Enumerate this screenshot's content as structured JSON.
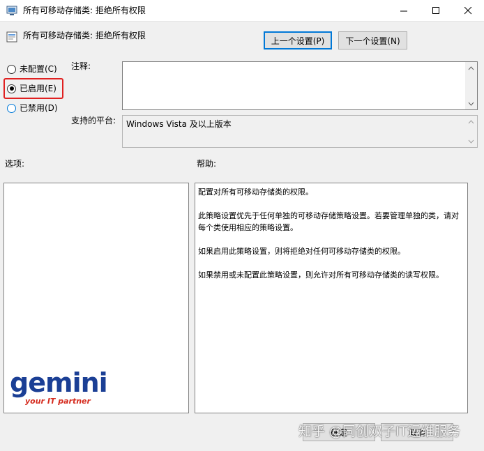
{
  "window": {
    "title": "所有可移动存储类: 拒绝所有权限",
    "controls": {
      "minimize": "minimize-icon",
      "maximize": "maximize-icon",
      "close": "close-icon"
    }
  },
  "header": {
    "policy_name": "所有可移动存储类: 拒绝所有权限",
    "prev_button": "上一个设置(P)",
    "next_button": "下一个设置(N)"
  },
  "state_options": {
    "not_configured": "未配置(C)",
    "enabled": "已启用(E)",
    "disabled": "已禁用(D)",
    "selected": "enabled"
  },
  "fields": {
    "comment_label": "注释:",
    "comment_value": "",
    "platform_label": "支持的平台:",
    "platform_value": "Windows Vista 及以上版本"
  },
  "sections": {
    "options_label": "选项:",
    "help_label": "帮助:"
  },
  "help_text": [
    "配置对所有可移动存储类的权限。",
    "此策略设置优先于任何单独的可移动存储策略设置。若要管理单独的类，请对每个类使用相应的策略设置。",
    "如果启用此策略设置，则将拒绝对任何可移动存储类的权限。",
    "如果禁用或未配置此策略设置，则允许对所有可移动存储类的读写权限。"
  ],
  "logo": {
    "word": "gemini",
    "tagline": "your IT partner"
  },
  "footer": {
    "ok_button": "确定",
    "cancel_button": "取消"
  },
  "watermark": "知乎 @同创双子IT运维服务",
  "colors": {
    "highlight": "#e02020",
    "focus": "#0078d7",
    "logo_blue": "#1b3f95",
    "logo_red": "#d52b1e"
  }
}
